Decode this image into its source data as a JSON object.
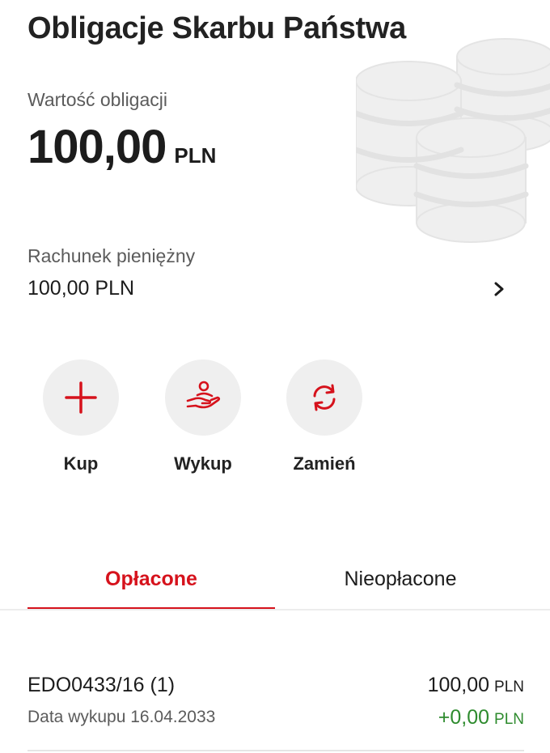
{
  "header": {
    "title": "Obligacje Skarbu Państwa"
  },
  "value": {
    "label": "Wartość obligacji",
    "amount": "100,00",
    "currency": "PLN"
  },
  "account": {
    "label": "Rachunek pieniężny",
    "value": "100,00 PLN"
  },
  "actions": [
    {
      "label": "Kup",
      "icon": "plus-icon"
    },
    {
      "label": "Wykup",
      "icon": "hand-coin-icon"
    },
    {
      "label": "Zamień",
      "icon": "exchange-icon"
    }
  ],
  "tabs": [
    {
      "label": "Opłacone",
      "active": true
    },
    {
      "label": "Nieopłacone",
      "active": false
    }
  ],
  "bonds": [
    {
      "name": "EDO0433/16 (1)",
      "redemption": "Data wykupu 16.04.2033",
      "amount": "100,00",
      "amount_currency": "PLN",
      "change": "+0,00",
      "change_currency": "PLN"
    }
  ],
  "colors": {
    "accent": "#d6121c",
    "positive": "#2e8b2e",
    "background": "#ffffff",
    "decor": "#e9e9e9"
  }
}
